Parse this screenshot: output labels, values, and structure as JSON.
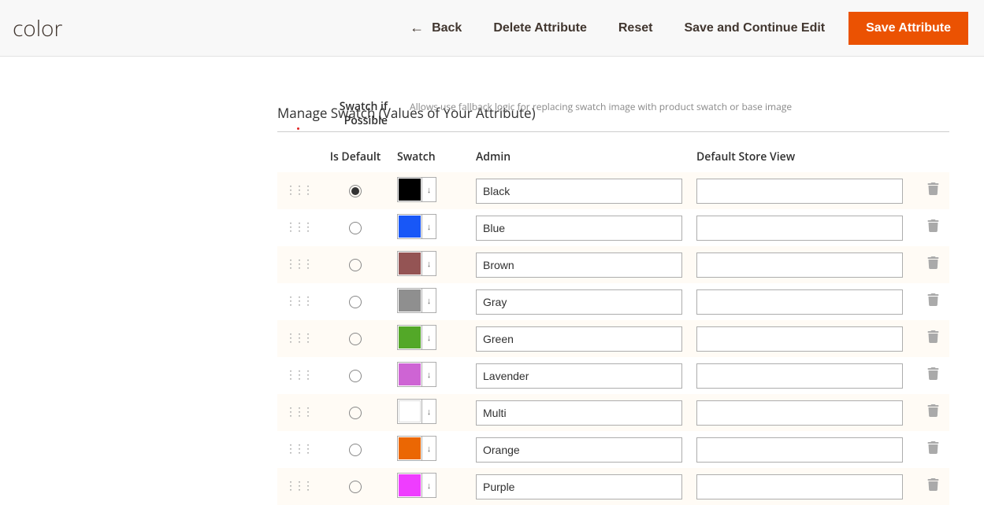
{
  "header": {
    "title": "color",
    "back": "Back",
    "delete": "Delete Attribute",
    "reset": "Reset",
    "save_cont": "Save and Continue Edit",
    "save": "Save Attribute"
  },
  "upper": {
    "label_line1": "Swatch if",
    "label_line2": "Possible",
    "note": "Allows use fallback logic for replacing swatch image with product swatch or base image"
  },
  "section": {
    "title": "Manage Swatch (Values of Your Attribute)"
  },
  "columns": {
    "is_default": "Is Default",
    "swatch": "Swatch",
    "admin": "Admin",
    "store": "Default Store View"
  },
  "rows": [
    {
      "admin": "Black",
      "store": "",
      "color": "#000000",
      "default": true
    },
    {
      "admin": "Blue",
      "store": "",
      "color": "#1857f7",
      "default": false
    },
    {
      "admin": "Brown",
      "store": "",
      "color": "#945454",
      "default": false
    },
    {
      "admin": "Gray",
      "store": "",
      "color": "#8f8f8f",
      "default": false
    },
    {
      "admin": "Green",
      "store": "",
      "color": "#53a828",
      "default": false
    },
    {
      "admin": "Lavender",
      "store": "",
      "color": "#ce64d4",
      "default": false
    },
    {
      "admin": "Multi",
      "store": "",
      "color": "#ffffff",
      "default": false
    },
    {
      "admin": "Orange",
      "store": "",
      "color": "#eb6703",
      "default": false
    },
    {
      "admin": "Purple",
      "store": "",
      "color": "#ef3dff",
      "default": false
    }
  ]
}
